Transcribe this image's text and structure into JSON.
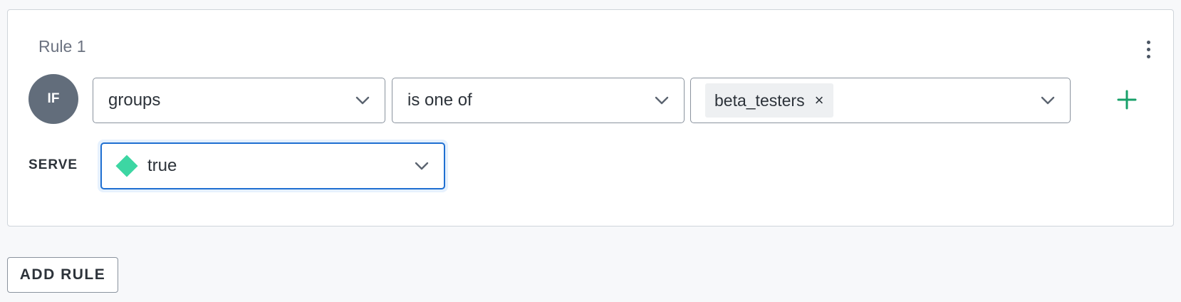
{
  "rule": {
    "title": "Rule 1",
    "if_label": "IF",
    "attribute": "groups",
    "operator": "is one of",
    "values": [
      "beta_testers"
    ],
    "chip_remove_glyph": "×",
    "serve_label": "SERVE",
    "serve_value": "true"
  },
  "actions": {
    "add_rule_label": "ADD RULE"
  },
  "colors": {
    "accent": "#1f6fd1",
    "add_icon": "#18a06a",
    "variation_true": "#3dd6a3",
    "badge": "#626d7b"
  },
  "icons": {
    "menu": "more-vertical-icon",
    "add": "plus-icon",
    "dropdown": "chevron-down-icon",
    "remove": "close-icon",
    "variation": "diamond-icon"
  }
}
